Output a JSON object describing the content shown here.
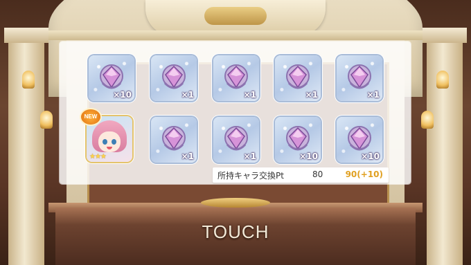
{
  "colors": {
    "panel_bg": "#ffffff",
    "pt_new_color": "#e0a020",
    "touch_color": "#f3ead8"
  },
  "results": {
    "row1": [
      {
        "icon": "memory-piece-icon",
        "quantity": "×10"
      },
      {
        "icon": "memory-piece-icon",
        "quantity": "×1"
      },
      {
        "icon": "memory-piece-icon",
        "quantity": "×1"
      },
      {
        "icon": "memory-piece-icon",
        "quantity": "×1"
      },
      {
        "icon": "memory-piece-icon",
        "quantity": "×1"
      }
    ],
    "character": {
      "badge": "NEW",
      "stars": "★★★"
    },
    "row2": [
      {
        "icon": "memory-piece-icon",
        "quantity": "×1"
      },
      {
        "icon": "memory-piece-icon",
        "quantity": "×1"
      },
      {
        "icon": "memory-piece-icon",
        "quantity": "×10"
      },
      {
        "icon": "memory-piece-icon",
        "quantity": "×10"
      }
    ]
  },
  "points": {
    "label": "所持キャラ交換Pt",
    "current": "80",
    "new": "90(+10)"
  },
  "touch_label": "TOUCH"
}
